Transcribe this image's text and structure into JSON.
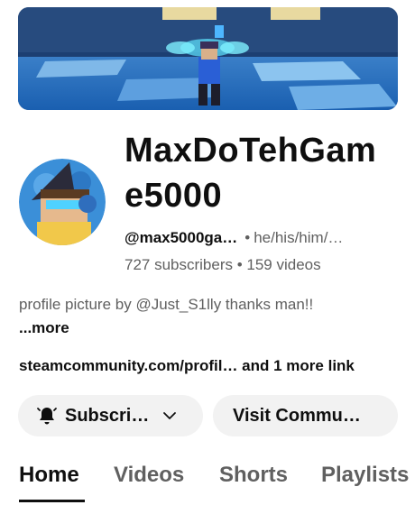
{
  "channel": {
    "name_line1": "MaxDoTehGam",
    "name_line2": "e5000",
    "handle": "@max5000ga…",
    "pronouns": "he/his/him/…",
    "separator": "•",
    "stats": "727 subscribers • 159 videos"
  },
  "description": {
    "text": "profile picture by @Just_S1lly thanks man!! ",
    "more_label": "...more"
  },
  "links": {
    "text": "steamcommunity.com/profil… and 1 more link"
  },
  "buttons": {
    "subscribe_label": "Subscri…",
    "visit_label": "Visit Commu…"
  },
  "tabs": [
    {
      "label": "Home",
      "active": true
    },
    {
      "label": "Videos",
      "active": false
    },
    {
      "label": "Shorts",
      "active": false
    },
    {
      "label": "Playlists",
      "active": false
    }
  ],
  "icons": {
    "subscribe": "bell-icon",
    "dropdown": "chevron-down-icon"
  },
  "colors": {
    "text_primary": "#0f0f0f",
    "text_secondary": "#606060",
    "button_bg": "#f2f2f2"
  }
}
